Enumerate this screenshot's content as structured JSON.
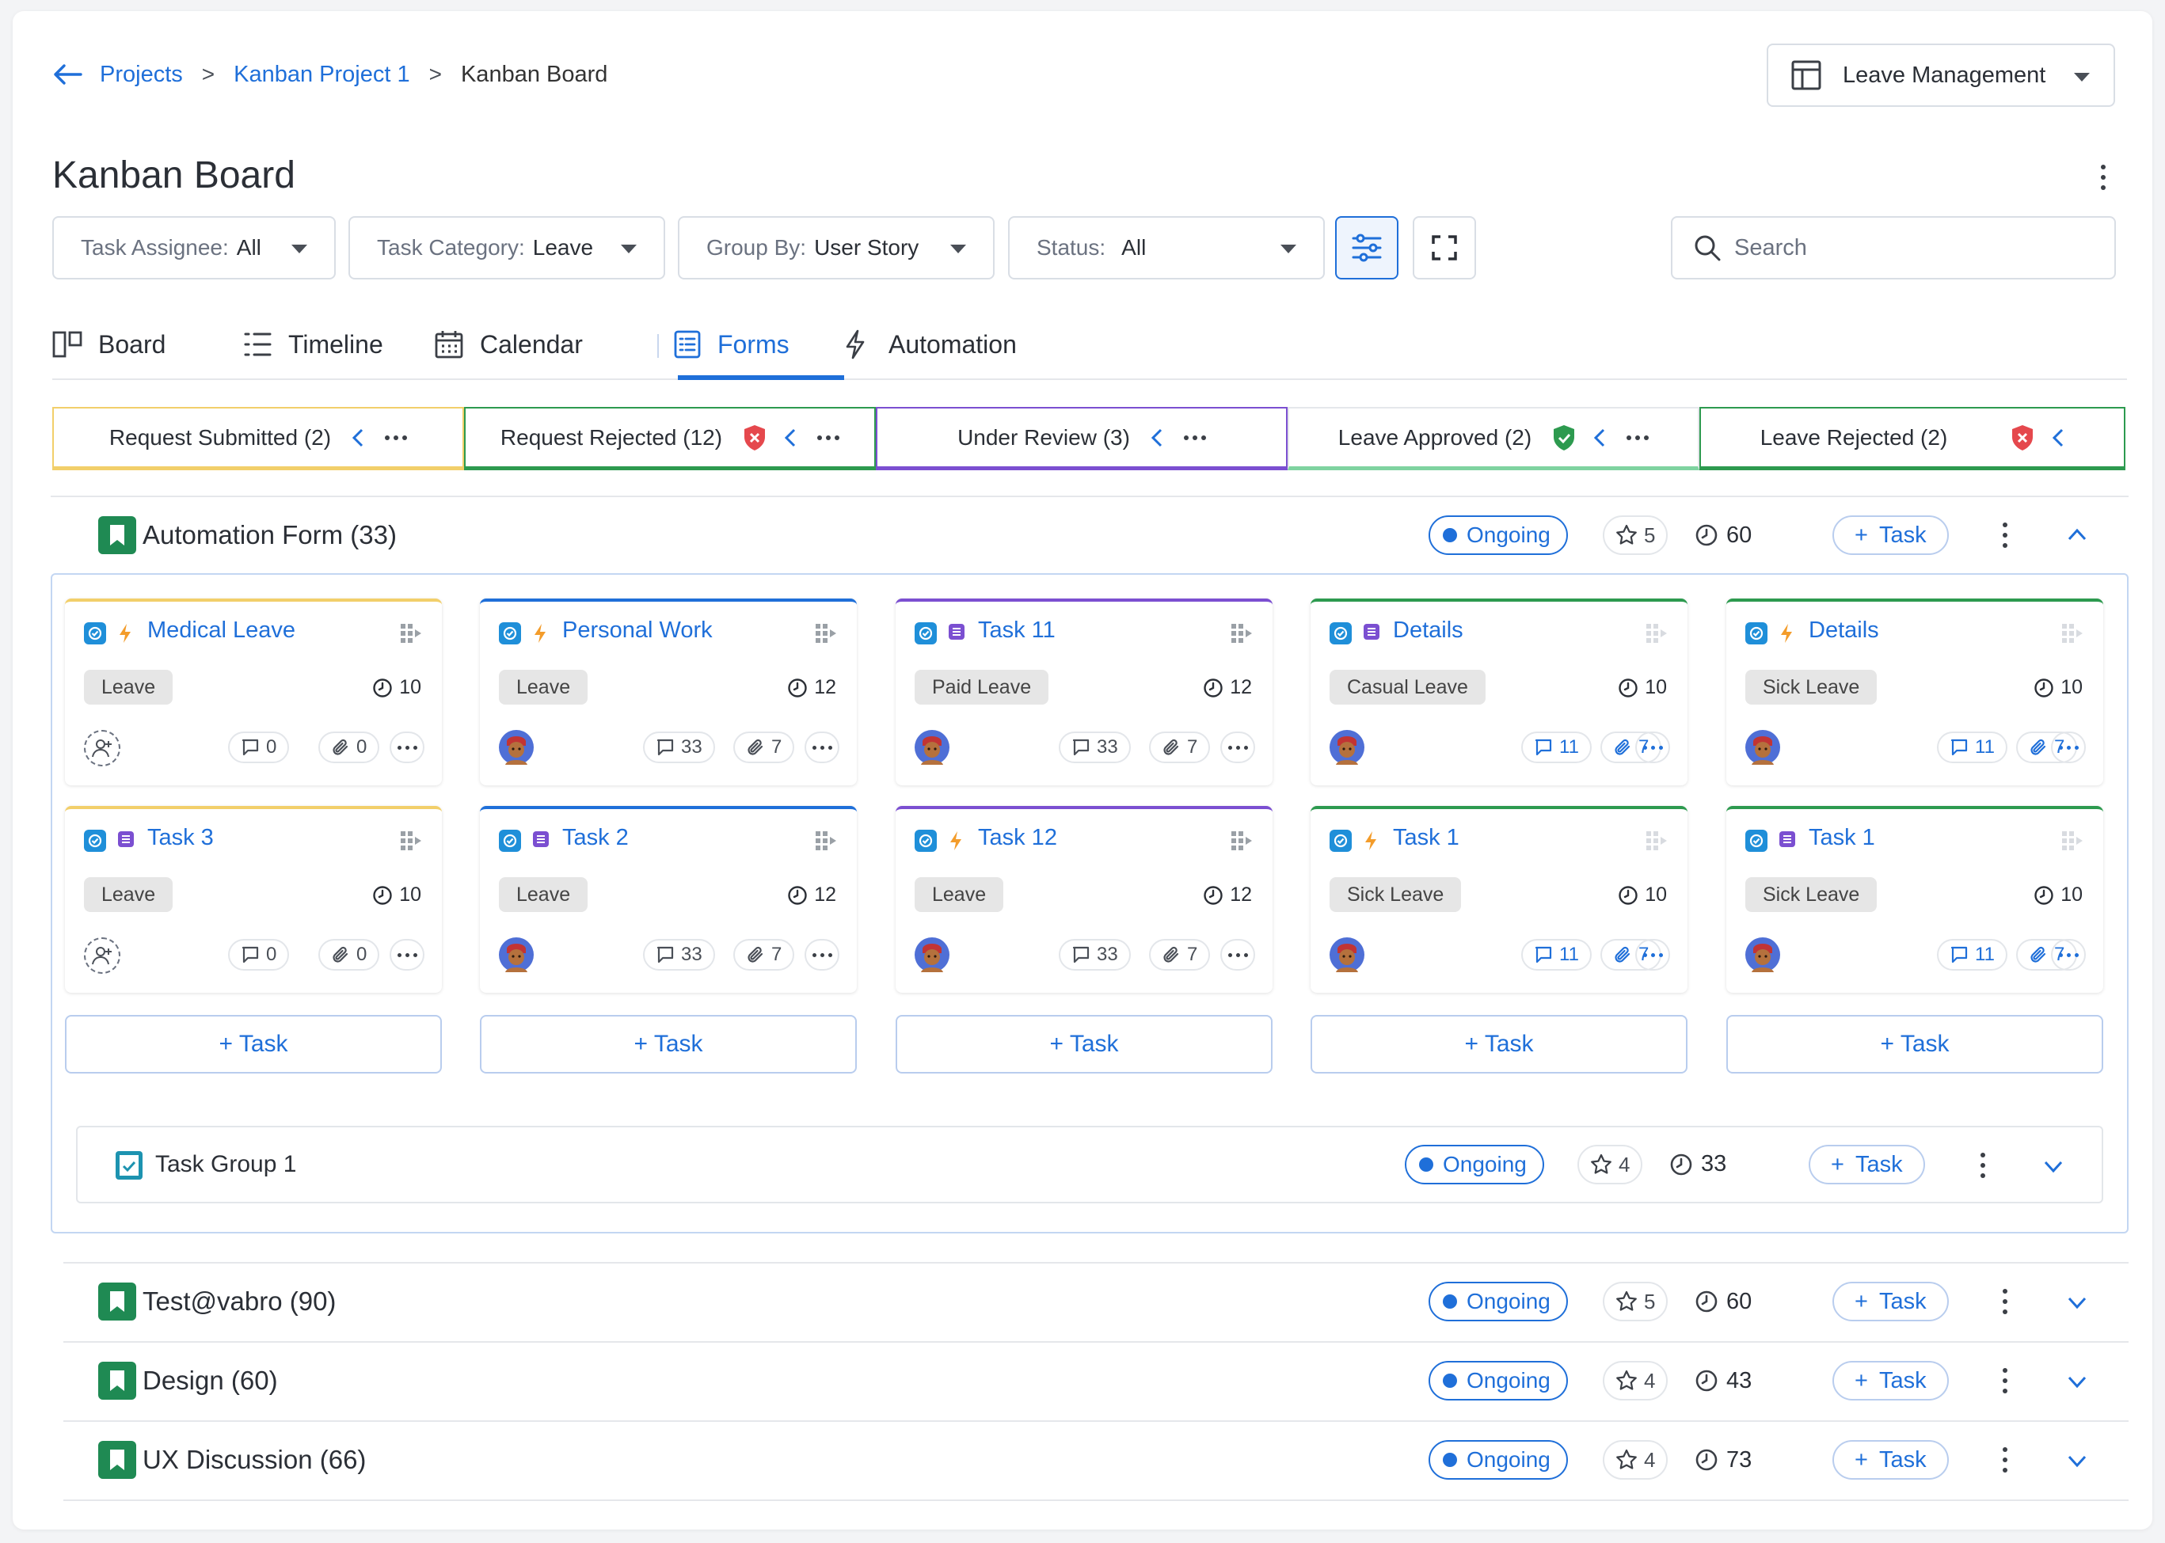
{
  "breadcrumb": {
    "items": [
      "Projects",
      "Kanban Project 1",
      "Kanban Board"
    ],
    "sep": ">"
  },
  "project_select": {
    "value": "Leave Management"
  },
  "page_title": "Kanban Board",
  "filters": {
    "assignee": {
      "label": "Task Assignee:",
      "value": "All"
    },
    "category": {
      "label": "Task Category:",
      "value": "Leave"
    },
    "group_by": {
      "label": "Group By:",
      "value": "User Story"
    },
    "status": {
      "label": "Status:",
      "value": "All"
    }
  },
  "search": {
    "placeholder": "Search"
  },
  "tabs": [
    "Board",
    "Timeline",
    "Calendar",
    "Forms",
    "Automation"
  ],
  "active_tab": "Forms",
  "columns": [
    {
      "label": "Request Submitted (2)",
      "color": "#f2cf6a"
    },
    {
      "label": "Request Rejected (12)",
      "color": "#2d9a4f",
      "shield": "red"
    },
    {
      "label": "Under Review (3)",
      "color": "#7b4fd1"
    },
    {
      "label": "Leave Approved (2)",
      "color": "#2d9a4f",
      "shield": "green"
    },
    {
      "label": "Leave Rejected (2)",
      "color": "#2d9a4f",
      "shield": "red"
    }
  ],
  "colors": {
    "accent": "#1f6fd9",
    "green": "#1f8a53",
    "yellow": "#f2cf6a",
    "purple": "#7b4fd1",
    "blue_top": "#1f6fd9",
    "shield_red": "#e5484d",
    "shield_green": "#2d9a4f"
  },
  "groups": [
    {
      "name": "Automation Form (33)",
      "status": "Ongoing",
      "stars": "5",
      "time": "60",
      "add": "Task"
    },
    {
      "name": "Test@vabro (90)",
      "status": "Ongoing",
      "stars": "5",
      "time": "60",
      "add": "Task"
    },
    {
      "name": "Design (60)",
      "status": "Ongoing",
      "stars": "4",
      "time": "43",
      "add": "Task"
    },
    {
      "name": "UX Discussion (66)",
      "status": "Ongoing",
      "stars": "4",
      "time": "73",
      "add": "Task"
    }
  ],
  "subgroup": {
    "name": "Task Group 1",
    "status": "Ongoing",
    "stars": "4",
    "time": "33",
    "add": "Task"
  },
  "add_card_label": "+ Task",
  "cards": [
    [
      {
        "title": "Medical Leave",
        "type": "bolt",
        "tag": "Leave",
        "time": "10",
        "comments": "0",
        "attach": "0",
        "assigned": false
      },
      {
        "title": "Task 3",
        "type": "story",
        "tag": "Leave",
        "time": "10",
        "comments": "0",
        "attach": "0",
        "assigned": false
      }
    ],
    [
      {
        "title": "Personal Work",
        "type": "bolt",
        "tag": "Leave",
        "time": "12",
        "comments": "33",
        "attach": "7",
        "assigned": true
      },
      {
        "title": "Task 2",
        "type": "story",
        "tag": "Leave",
        "time": "12",
        "comments": "33",
        "attach": "7",
        "assigned": true
      }
    ],
    [
      {
        "title": "Task 11",
        "type": "story",
        "tag": "Paid Leave",
        "time": "12",
        "comments": "33",
        "attach": "7",
        "assigned": true
      },
      {
        "title": "Task 12",
        "type": "bolt",
        "tag": "Leave",
        "time": "12",
        "comments": "33",
        "attach": "7",
        "assigned": true
      }
    ],
    [
      {
        "title": "Details",
        "type": "story",
        "tag": "Casual Leave",
        "time": "10",
        "comments": "11",
        "attach": "7",
        "assigned": true
      },
      {
        "title": "Task 1",
        "type": "bolt",
        "tag": "Sick Leave",
        "time": "10",
        "comments": "11",
        "attach": "7",
        "assigned": true
      }
    ],
    [
      {
        "title": "Details",
        "type": "bolt",
        "tag": "Sick Leave",
        "time": "10",
        "comments": "11",
        "attach": "7",
        "assigned": true
      },
      {
        "title": "Task 1",
        "type": "story",
        "tag": "Sick Leave",
        "time": "10",
        "comments": "11",
        "attach": "7",
        "assigned": true
      }
    ]
  ]
}
